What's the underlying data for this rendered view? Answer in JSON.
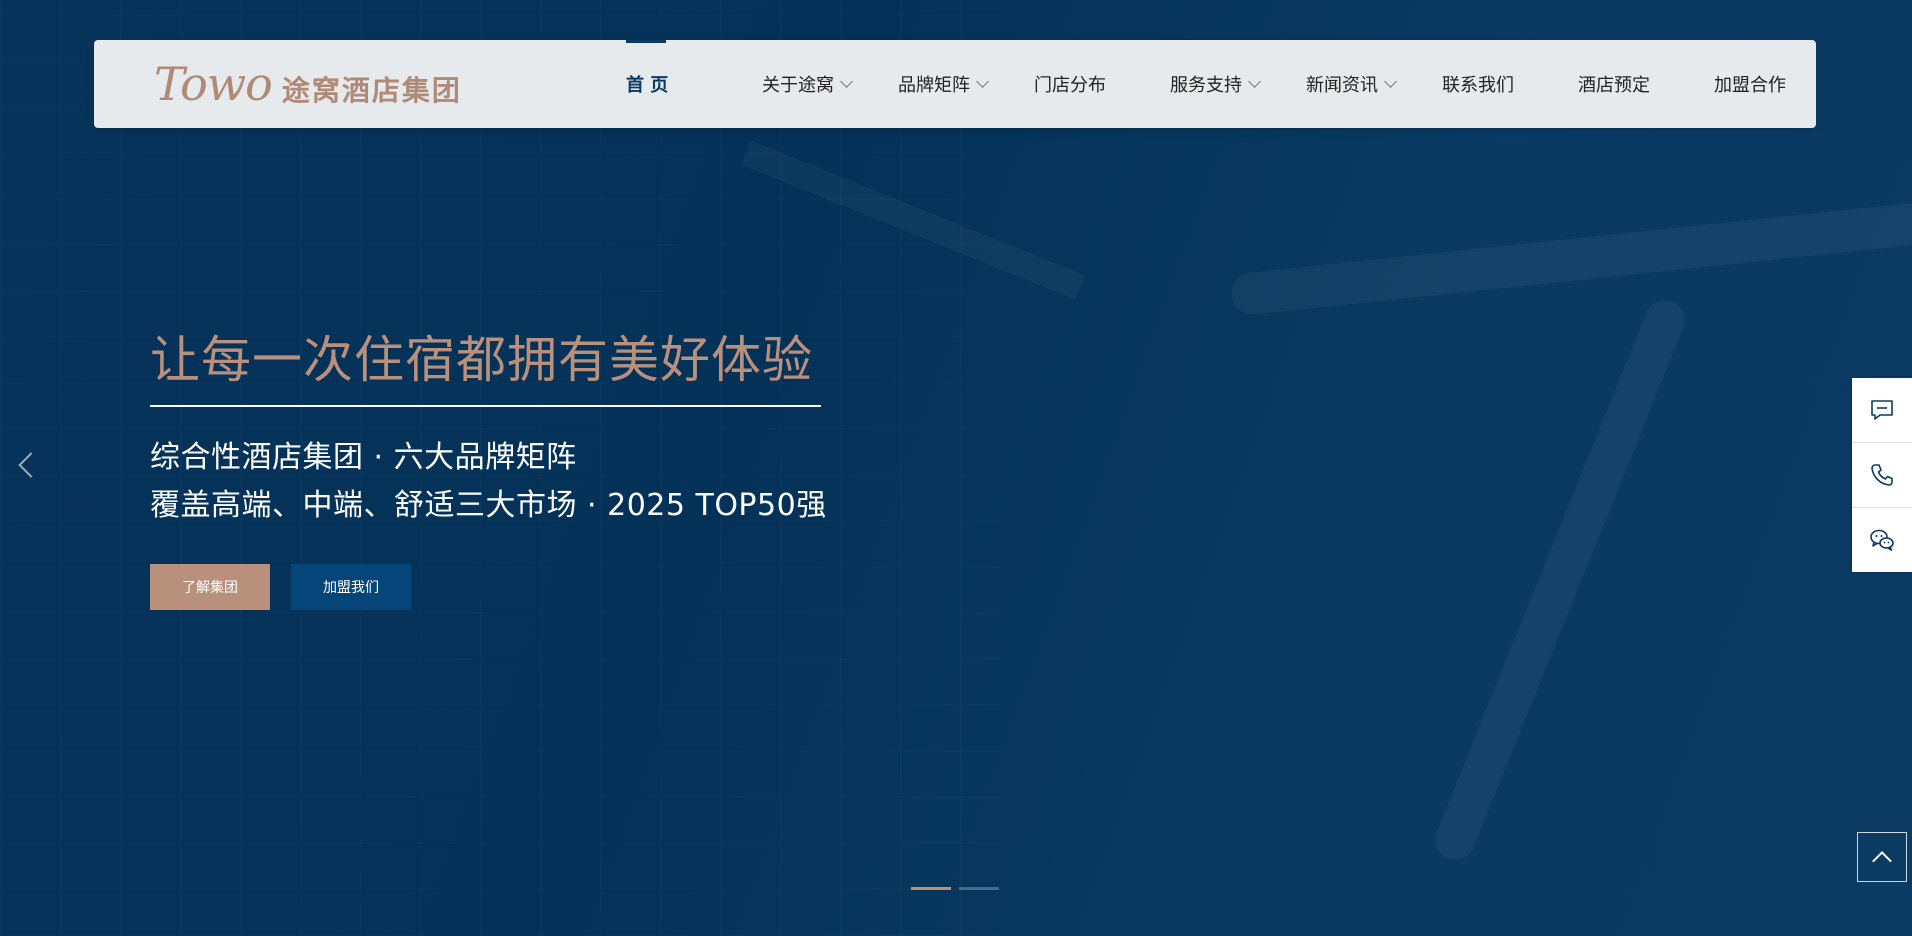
{
  "logo": {
    "script": "Towo",
    "name": "途窝酒店集团"
  },
  "nav": {
    "items": [
      {
        "label": "首 页",
        "active": true,
        "dropdown": false
      },
      {
        "label": "关于途窝",
        "active": false,
        "dropdown": true
      },
      {
        "label": "品牌矩阵",
        "active": false,
        "dropdown": true
      },
      {
        "label": "门店分布",
        "active": false,
        "dropdown": false
      },
      {
        "label": "服务支持",
        "active": false,
        "dropdown": true
      },
      {
        "label": "新闻资讯",
        "active": false,
        "dropdown": true
      },
      {
        "label": "联系我们",
        "active": false,
        "dropdown": false
      },
      {
        "label": "酒店预定",
        "active": false,
        "dropdown": false
      },
      {
        "label": "加盟合作",
        "active": false,
        "dropdown": false
      }
    ]
  },
  "hero": {
    "title": "让每一次住宿都拥有美好体验",
    "line1": "综合性酒店集团 · 六大品牌矩阵",
    "line2": "覆盖高端、中端、舒适三大市场 · 2025 TOP50强",
    "primary_button": "了解集团",
    "secondary_button": "加盟我们"
  },
  "slider": {
    "current": 1,
    "total": 2
  },
  "sidebar": {
    "icons": [
      "message-icon",
      "phone-icon",
      "wechat-icon"
    ]
  },
  "colors": {
    "background": "#043157",
    "accent": "#b8907c",
    "nav_active": "#0b3b63",
    "header_bg": "#e6eaed"
  }
}
